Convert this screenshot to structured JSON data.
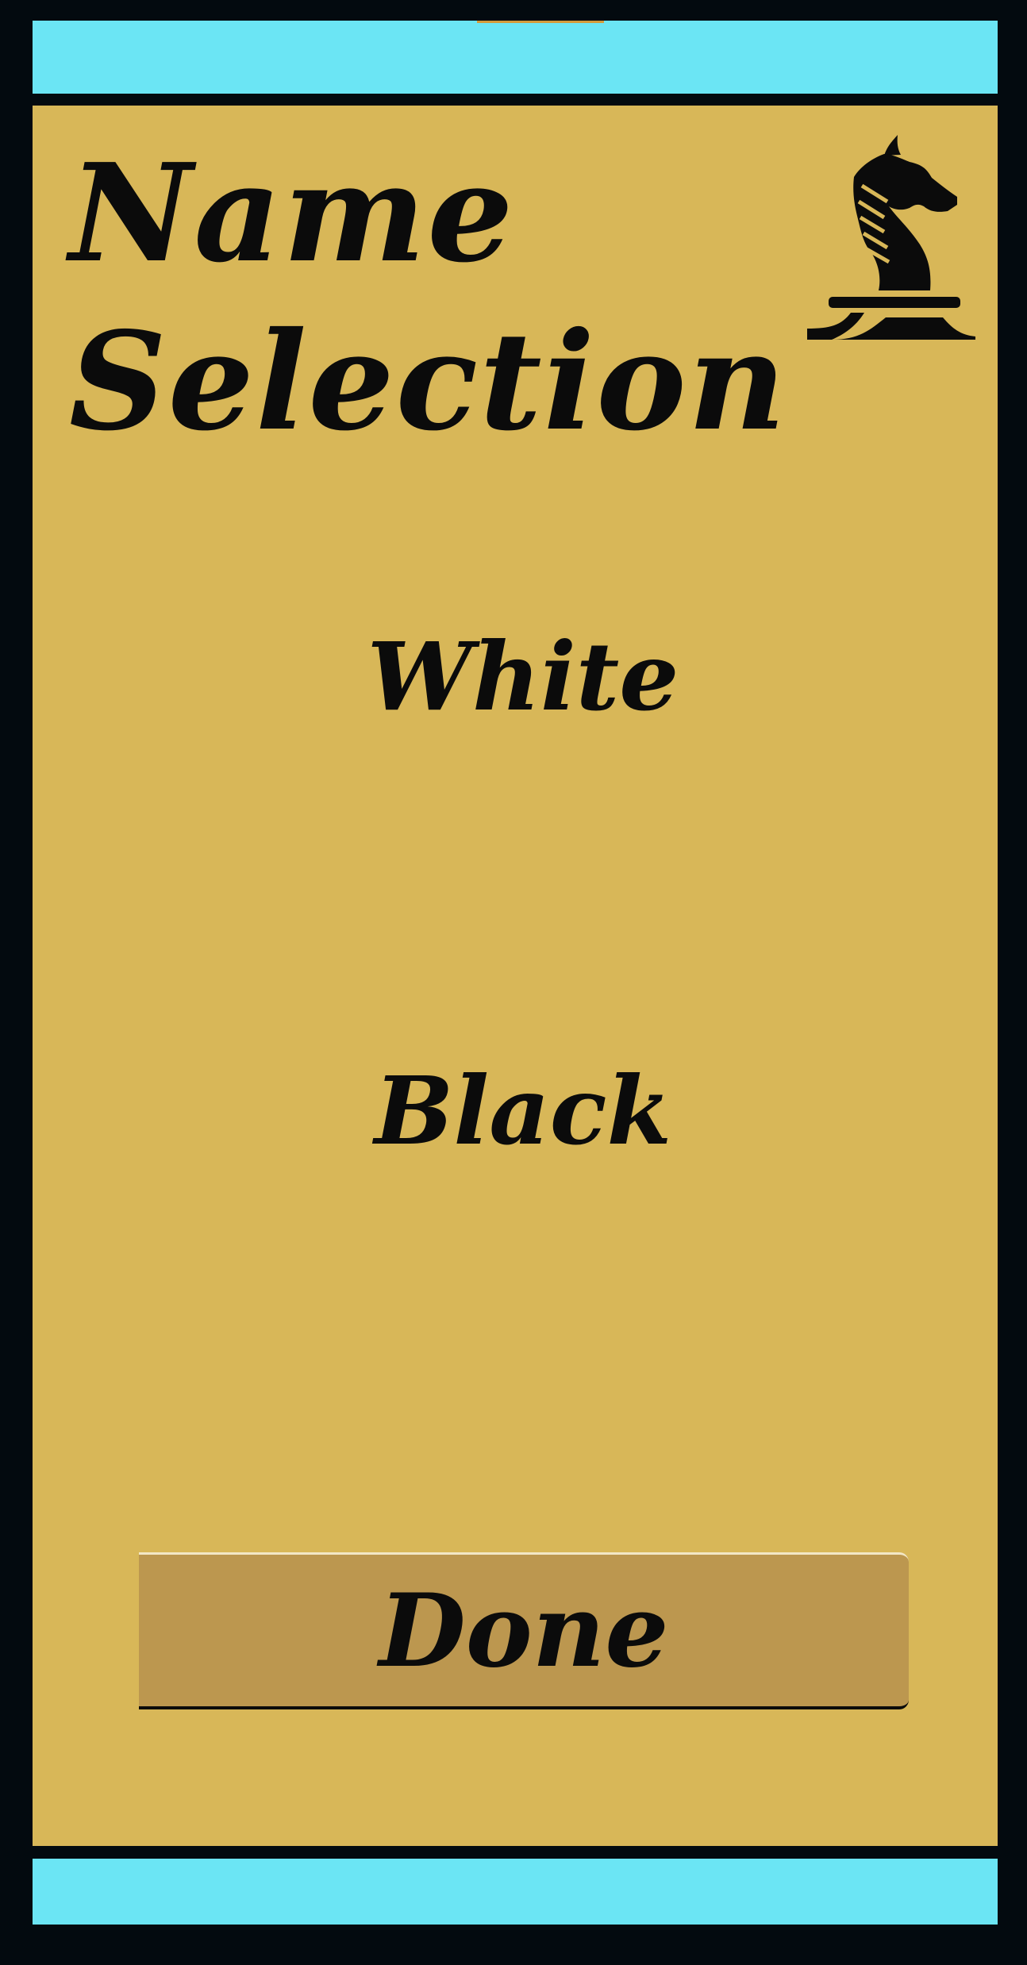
{
  "screen": {
    "title_line1": "Name",
    "title_line2": "Selection",
    "logo_icon": "chess-knight-icon"
  },
  "choices": {
    "white_label": "White",
    "black_label": "Black"
  },
  "actions": {
    "done_label": "Done"
  },
  "colors": {
    "frame": "#030a0f",
    "bars": "#6be5f4",
    "panel": "#d8b758",
    "button": "#bc974f",
    "text": "#0b0b0b"
  }
}
